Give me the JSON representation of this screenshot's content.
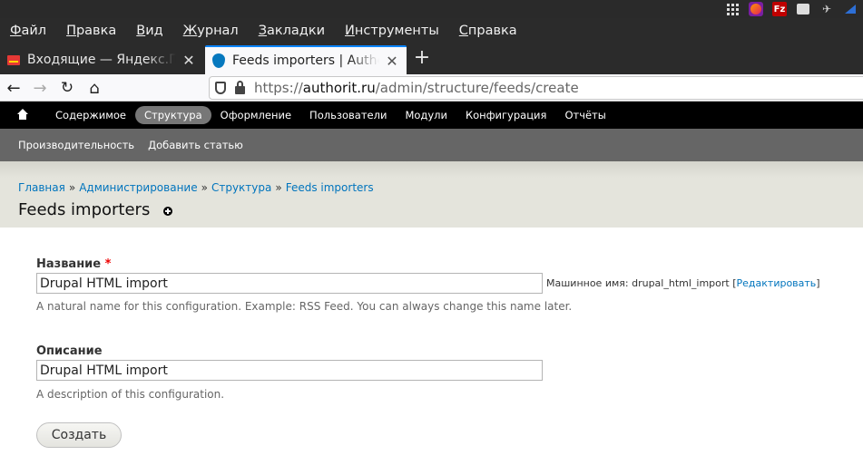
{
  "os_bar": {
    "icons": [
      "apps-grid-icon",
      "firefox-icon",
      "filezilla-icon",
      "window-icon",
      "bird-icon",
      "triangle-icon"
    ],
    "filezilla_label": "Fz"
  },
  "menu": {
    "items": [
      {
        "label": "Файл",
        "key": "Ф",
        "rest": "айл"
      },
      {
        "label": "Правка",
        "key": "П",
        "rest": "равка"
      },
      {
        "label": "Вид",
        "key": "В",
        "rest": "ид"
      },
      {
        "label": "Журнал",
        "key": "Ж",
        "rest": "урнал"
      },
      {
        "label": "Закладки",
        "key": "З",
        "rest": "акладки"
      },
      {
        "label": "Инструменты",
        "key": "И",
        "rest": "нструменты"
      },
      {
        "label": "Справка",
        "key": "С",
        "rest": "правка"
      }
    ]
  },
  "tabs": [
    {
      "title": "Входящие — Яндекс.Почта",
      "icon": "gmail-icon",
      "active": false
    },
    {
      "title": "Feeds importers | Authorit",
      "icon": "drupal-icon",
      "active": true
    }
  ],
  "tab_close": "✕",
  "new_tab": "+",
  "nav": {
    "back": "←",
    "forward": "→",
    "reload": "↻",
    "home": "⌂",
    "url_prefix": "https://",
    "url_host": "authorit.ru",
    "url_path": "/admin/structure/feeds/create"
  },
  "admin_toolbar": {
    "items": [
      "Содержимое",
      "Структура",
      "Оформление",
      "Пользователи",
      "Модули",
      "Конфигурация",
      "Отчёты"
    ],
    "active_index": 1
  },
  "shortcuts": [
    "Производительность",
    "Добавить статью"
  ],
  "breadcrumb": {
    "items": [
      "Главная",
      "Администрирование",
      "Структура",
      "Feeds importers"
    ],
    "separator": "»"
  },
  "page": {
    "title": "Feeds importers"
  },
  "form": {
    "name_label": "Название",
    "required_mark": "*",
    "name_value": "Drupal HTML import",
    "machine_name_prefix": "Машинное имя: drupal_html_import [",
    "machine_name_edit": "Редактировать",
    "machine_name_suffix": "]",
    "name_description": "A natural name for this configuration. Example: RSS Feed. You can always change this name later.",
    "description_label": "Описание",
    "description_value": "Drupal HTML import",
    "description_description": "A description of this configuration.",
    "submit_label": "Создать"
  },
  "colors": {
    "link": "#0074bd",
    "accent_tab": "#0a84ff",
    "required": "#e00000"
  }
}
